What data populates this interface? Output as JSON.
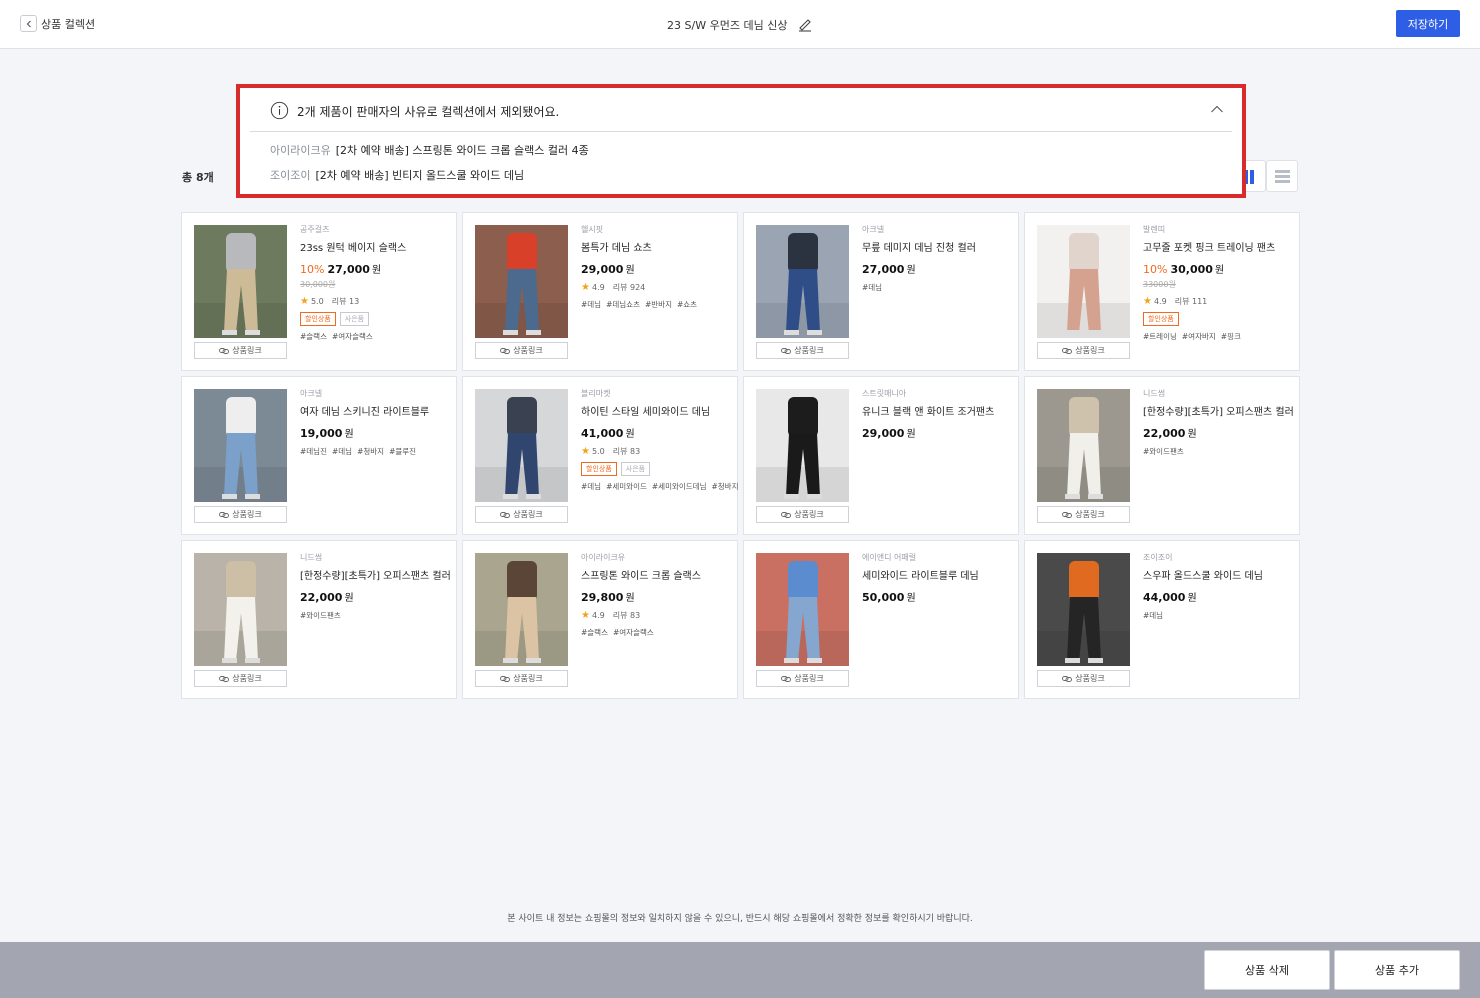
{
  "header": {
    "back_label": "상품 컬렉션",
    "title": "23 S/W 우먼즈 데님 신상",
    "save_label": "저장하기"
  },
  "total_count": "총 8개",
  "notice": {
    "title": "2개 제품이 판매자의 사유로 컬렉션에서 제외됐어요.",
    "items": [
      {
        "brand": "아이라이크유",
        "name": "[2차 예약 배송] 스프링톤 와이드 크롭 슬랙스 컬러 4종"
      },
      {
        "brand": "조이조이",
        "name": "[2차 예약 배송] 빈티지 올드스쿨 와이드 데님"
      }
    ]
  },
  "link_label": "상품링크",
  "won": "원",
  "badge_sale": "할인상품",
  "badge_gift": "사은품",
  "review_prefix": "리뷰",
  "products": [
    {
      "brand": "공주걸즈",
      "name": "23ss 원턱 베이지 슬랙스",
      "discount": "10%",
      "price": "27,000",
      "orig": "30,000원",
      "rating": "5.0",
      "reviews": "13",
      "sale": true,
      "gift": true,
      "tags": [
        "#슬랙스",
        "#여자슬랙스"
      ]
    },
    {
      "brand": "헬시핏",
      "name": "봄특가 데님 쇼츠",
      "discount": "",
      "price": "29,000",
      "orig": "",
      "rating": "4.9",
      "reviews": "924",
      "sale": false,
      "gift": false,
      "tags": [
        "#데님",
        "#데님쇼츠",
        "#반바지",
        "#쇼츠"
      ]
    },
    {
      "brand": "아크넬",
      "name": "무릎 데미지 데님 진청 컬러",
      "discount": "",
      "price": "27,000",
      "orig": "",
      "rating": "",
      "reviews": "",
      "sale": false,
      "gift": false,
      "tags": [
        "#데님"
      ]
    },
    {
      "brand": "발렌띠",
      "name": "고무줄 포켓 핑크 트레이닝 팬츠",
      "discount": "10%",
      "price": "30,000",
      "orig": "33000원",
      "rating": "4.9",
      "reviews": "111",
      "sale": true,
      "gift": false,
      "tags": [
        "#트레이닝",
        "#여자바지",
        "#핑크"
      ]
    },
    {
      "brand": "아크넬",
      "name": "여자 데님 스키니진 라이트블루",
      "discount": "",
      "price": "19,000",
      "orig": "",
      "rating": "",
      "reviews": "",
      "sale": false,
      "gift": false,
      "tags": [
        "#데님진",
        "#데님",
        "#청바지",
        "#블루진"
      ]
    },
    {
      "brand": "블리마켓",
      "name": "하이틴 스타일 세미와이드 데님",
      "discount": "",
      "price": "41,000",
      "orig": "",
      "rating": "5.0",
      "reviews": "83",
      "sale": true,
      "gift": true,
      "tags": [
        "#데님",
        "#세미와이드",
        "#세미와이드데님",
        "#청바지"
      ]
    },
    {
      "brand": "스트릿매니아",
      "name": "유니크 블랙 앤 화이트 조거팬츠",
      "discount": "",
      "price": "29,000",
      "orig": "",
      "rating": "",
      "reviews": "",
      "sale": false,
      "gift": false,
      "tags": []
    },
    {
      "brand": "니드썸",
      "name": "[한정수량][초특가] 오피스팬츠 컬러",
      "discount": "",
      "price": "22,000",
      "orig": "",
      "rating": "",
      "reviews": "",
      "sale": false,
      "gift": false,
      "tags": [
        "#와이드팬츠"
      ]
    },
    {
      "brand": "니드썸",
      "name": "[한정수량][초특가] 오피스팬츠 컬러",
      "discount": "",
      "price": "22,000",
      "orig": "",
      "rating": "",
      "reviews": "",
      "sale": false,
      "gift": false,
      "tags": [
        "#와이드팬츠"
      ]
    },
    {
      "brand": "아이라이크유",
      "name": "스프링톤 와이드 크롭 슬랙스",
      "discount": "",
      "price": "29,800",
      "orig": "",
      "rating": "4.9",
      "reviews": "83",
      "sale": false,
      "gift": false,
      "tags": [
        "#슬랙스",
        "#여자슬랙스"
      ]
    },
    {
      "brand": "에이앤디 어패럴",
      "name": "세미와이드 라이트블루 데님",
      "discount": "",
      "price": "50,000",
      "orig": "",
      "rating": "",
      "reviews": "",
      "sale": false,
      "gift": false,
      "tags": []
    },
    {
      "brand": "조이조이",
      "name": "스우파 올드스쿨 와이드 데님",
      "discount": "",
      "price": "44,000",
      "orig": "",
      "rating": "",
      "reviews": "",
      "sale": false,
      "gift": false,
      "tags": [
        "#데님"
      ]
    }
  ],
  "thumbs": [
    {
      "bg": "#6d7a5e",
      "top": "#b7b9bd",
      "pants": "#cdbb98"
    },
    {
      "bg": "#8b5e4e",
      "top": "#d8402a",
      "pants": "#4c6a8e"
    },
    {
      "bg": "#9aa4b3",
      "top": "#2b3240",
      "pants": "#2f4d87"
    },
    {
      "bg": "#f2f1ef",
      "top": "#e0d4cc",
      "pants": "#d4a28e"
    },
    {
      "bg": "#7c8a96",
      "top": "#eeeeee",
      "pants": "#7ba0c9"
    },
    {
      "bg": "#d6d7d9",
      "top": "#3a4252",
      "pants": "#31466e"
    },
    {
      "bg": "#e8e8e8",
      "top": "#1c1c1c",
      "pants": "#1a1a1a"
    },
    {
      "bg": "#9c9890",
      "top": "#cfc2ad",
      "pants": "#f1efe9"
    },
    {
      "bg": "#b9b3a9",
      "top": "#cdbea6",
      "pants": "#f3f1ec"
    },
    {
      "bg": "#a9a58f",
      "top": "#5a4536",
      "pants": "#dcc3a4"
    },
    {
      "bg": "#c97063",
      "top": "#5a8ccf",
      "pants": "#84a6cf"
    },
    {
      "bg": "#4a4a4a",
      "top": "#e06a20",
      "pants": "#252525"
    }
  ],
  "disclaimer": "본 사이트 내 정보는 쇼핑몰의 정보와 일치하지 않을 수 있으니, 반드시 해당 쇼핑몰에서 정확한 정보를 확인하시기 바랍니다.",
  "bottom": {
    "delete_label": "상품 삭제",
    "add_label": "상품 추가"
  }
}
